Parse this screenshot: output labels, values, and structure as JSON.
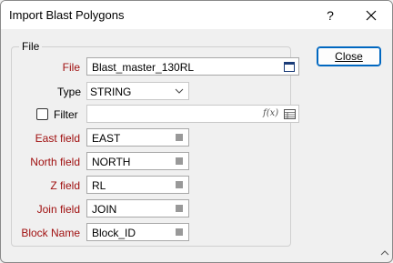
{
  "window": {
    "title": "Import Blast Polygons",
    "help_label": "?"
  },
  "group": {
    "legend": "File"
  },
  "file": {
    "label": "File",
    "value": "Blast_master_130RL"
  },
  "type": {
    "label": "Type",
    "value": "STRING"
  },
  "filter": {
    "label": "Filter",
    "checked": false,
    "value": "",
    "fx_label": "f(x)"
  },
  "fields": [
    {
      "label": "East field",
      "value": "EAST"
    },
    {
      "label": "North field",
      "value": "NORTH"
    },
    {
      "label": "Z field",
      "value": "RL"
    },
    {
      "label": "Join field",
      "value": "JOIN"
    },
    {
      "label": "Block Name",
      "value": "Block_ID"
    }
  ],
  "buttons": {
    "close": "Close"
  },
  "colors": {
    "required_label": "#a01010",
    "focus_border": "#0067c0"
  }
}
